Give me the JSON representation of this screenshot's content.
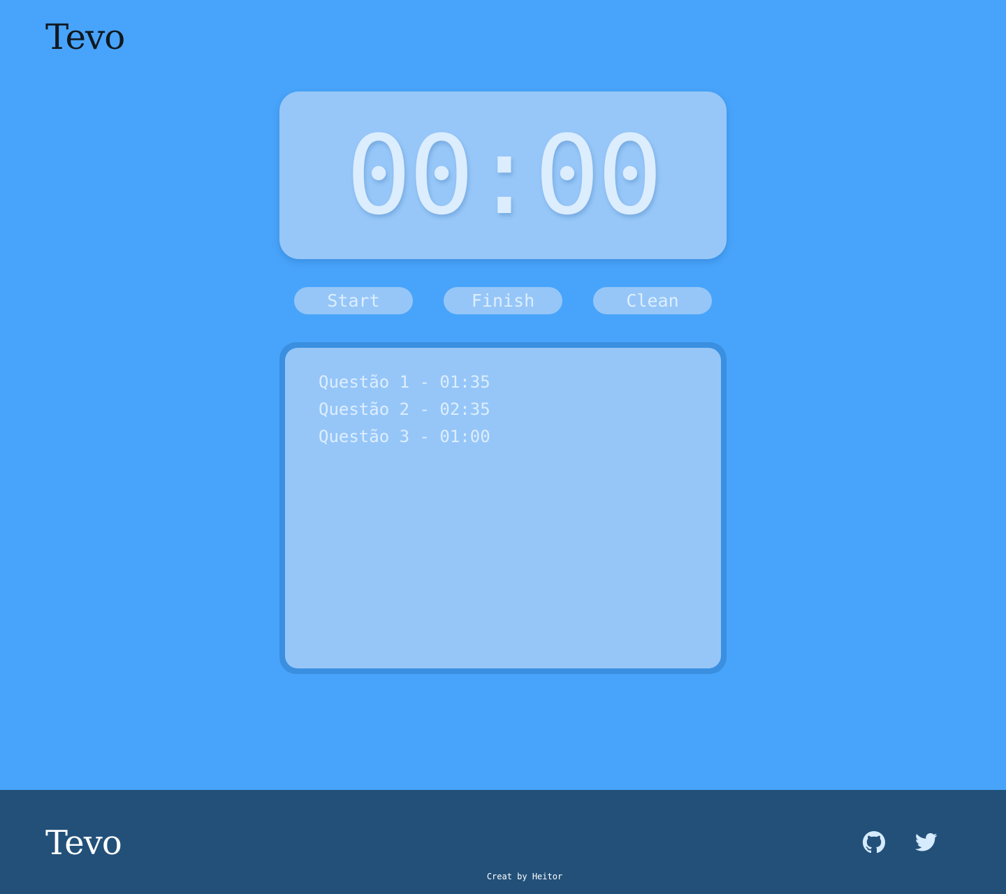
{
  "header": {
    "logo": "Tevo"
  },
  "timer": {
    "display": "00:00"
  },
  "controls": {
    "start_label": "Start",
    "finish_label": "Finish",
    "clean_label": "Clean"
  },
  "laps": {
    "items": [
      "Questão 1 - 01:35",
      "Questão 2 - 02:35",
      "Questão 3 - 01:00"
    ]
  },
  "footer": {
    "logo": "Tevo",
    "credit": "Creat by Heitor",
    "icons": [
      "github-icon",
      "twitter-icon"
    ]
  },
  "colors": {
    "background": "#48a4fa",
    "card": "#97c7f8",
    "footer": "#225079",
    "text_light": "#ddeefe"
  }
}
